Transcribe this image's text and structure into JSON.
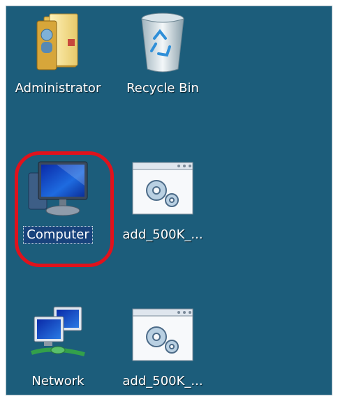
{
  "desktop": {
    "background_color": "#1c5d7b",
    "icons": [
      {
        "label": "Administrator",
        "icon": "user-folder-icon"
      },
      {
        "label": "Recycle Bin",
        "icon": "recycle-bin-icon"
      },
      {
        "label": "Computer",
        "icon": "computer-icon",
        "selected": true
      },
      {
        "label": "add_500K_...",
        "icon": "settings-file-icon"
      },
      {
        "label": "Network",
        "icon": "network-icon"
      },
      {
        "label": "add_500K_...",
        "icon": "settings-file-icon"
      }
    ]
  },
  "annotation": {
    "highlight_color": "#e0121c",
    "target": "Computer"
  }
}
